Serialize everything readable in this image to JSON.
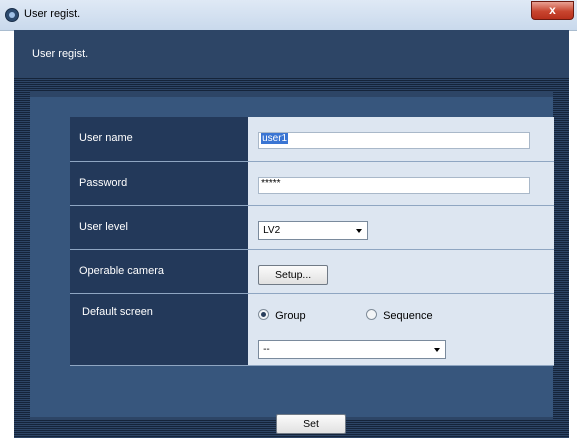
{
  "window": {
    "title": "User regist.",
    "close_label": "x",
    "app_icon": "camera-app-icon"
  },
  "header": {
    "title": "User regist."
  },
  "form": {
    "user_name": {
      "label": "User name",
      "value": "user1"
    },
    "password": {
      "label": "Password",
      "value": "*****"
    },
    "user_level": {
      "label": "User level",
      "value": "LV2"
    },
    "operable_camera": {
      "label": "Operable camera",
      "button": "Setup..."
    },
    "default_screen": {
      "label": "Default screen",
      "options": [
        "Group",
        "Sequence"
      ],
      "selected": "Group",
      "dropdown_value": "--"
    }
  },
  "actions": {
    "set_label": "Set"
  },
  "colors": {
    "frame": "#2d4566",
    "panel": "#37567d",
    "label_cell": "#23395a",
    "value_cell": "#dde6f1",
    "selection": "#3a75d3"
  }
}
